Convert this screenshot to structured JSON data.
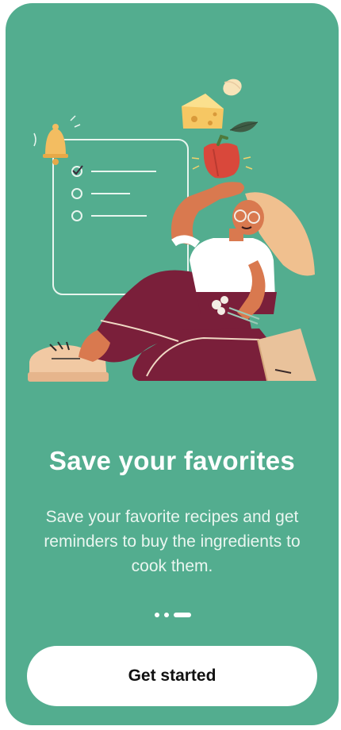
{
  "onboarding": {
    "title": "Save your favorites",
    "subtitle": "Save your favorite recipes and get reminders to buy the ingredients to cook them.",
    "pager": {
      "count": 3,
      "active_index": 2
    },
    "cta_label": "Get started"
  },
  "colors": {
    "background": "#53ad8f",
    "text": "#ffffff",
    "button": "#ffffff",
    "button_text": "#111111"
  }
}
